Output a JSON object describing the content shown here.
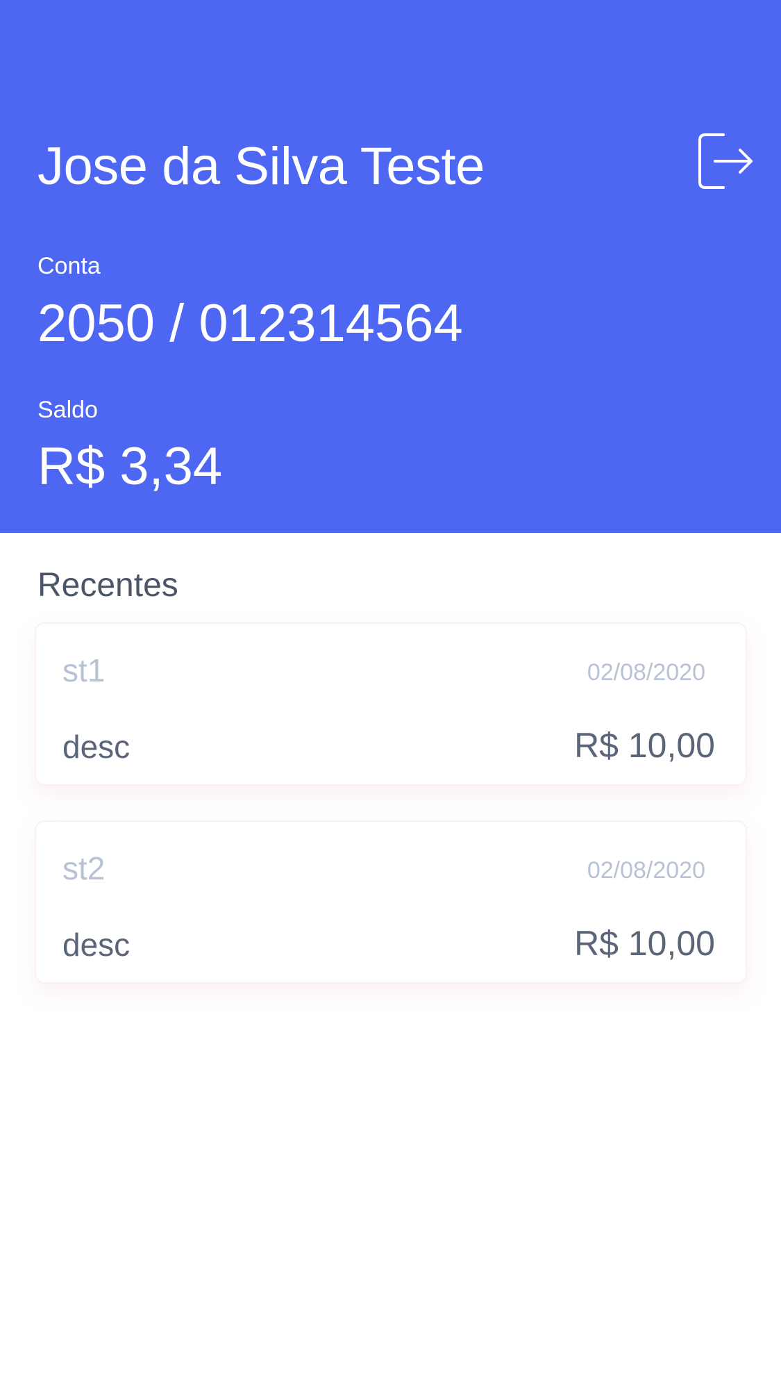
{
  "header": {
    "user_name": "Jose da Silva Teste",
    "logout_icon": "logout-icon",
    "background_color": "#4d67f3",
    "account": {
      "label": "Conta",
      "value": "2050 / 012314564"
    },
    "balance": {
      "label": "Saldo",
      "value": "R$ 3,34"
    }
  },
  "recent": {
    "title": "Recentes",
    "transactions": [
      {
        "title": "st1",
        "date": "02/08/2020",
        "description": "desc",
        "amount": "R$ 10,00"
      },
      {
        "title": "st2",
        "date": "02/08/2020",
        "description": "desc",
        "amount": "R$ 10,00"
      }
    ]
  }
}
